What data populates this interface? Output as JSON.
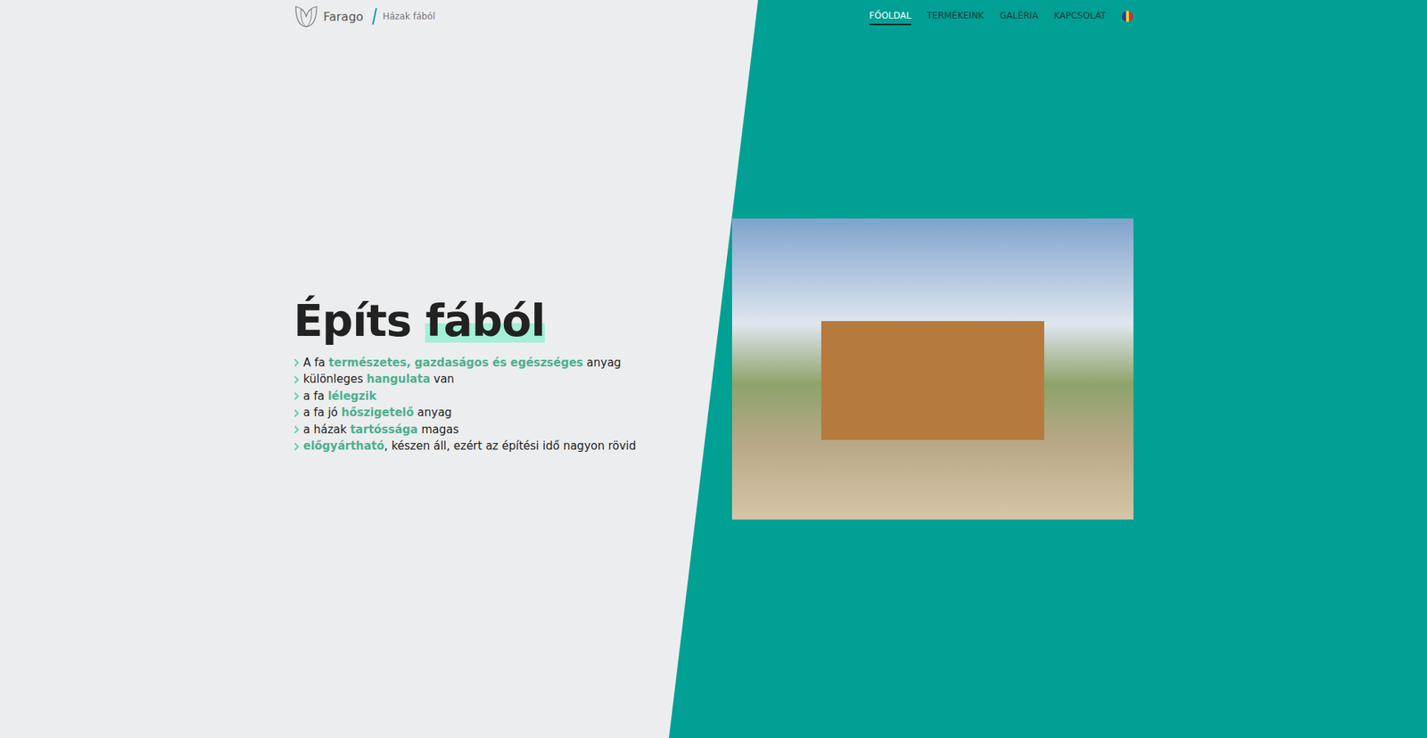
{
  "brand": {
    "name": "Farago",
    "tagline": "Házak fából"
  },
  "nav": [
    {
      "label": "FŐOLDAL",
      "selected": true
    },
    {
      "label": "TERMÉKEINK",
      "selected": false
    },
    {
      "label": "GALÉRIA",
      "selected": false
    },
    {
      "label": "KAPCSOLAT",
      "selected": false
    }
  ],
  "hero": {
    "title": [
      {
        "text": "Építs ",
        "highlight": false
      },
      {
        "text": "fából",
        "highlight": true
      }
    ],
    "bullets": [
      [
        {
          "text": "A fa ",
          "bold": false
        },
        {
          "text": "természetes, gazdaságos és egészséges",
          "bold": true
        },
        {
          "text": " anyag",
          "bold": false
        }
      ],
      [
        {
          "text": "különleges ",
          "bold": false
        },
        {
          "text": "hangulata",
          "bold": true
        },
        {
          "text": " van",
          "bold": false
        }
      ],
      [
        {
          "text": "a fa ",
          "bold": false
        },
        {
          "text": "lélegzik",
          "bold": true
        }
      ],
      [
        {
          "text": "a fa jó ",
          "bold": false
        },
        {
          "text": "hőszigetelő",
          "bold": true
        },
        {
          "text": " anyag",
          "bold": false
        }
      ],
      [
        {
          "text": "a házak ",
          "bold": false
        },
        {
          "text": "tartóssága",
          "bold": true
        },
        {
          "text": " magas",
          "bold": false
        }
      ],
      [
        {
          "text": "előgyártható",
          "bold": true
        },
        {
          "text": ", készen áll, ezért az építési idő nagyon rövid",
          "bold": false
        }
      ]
    ]
  }
}
